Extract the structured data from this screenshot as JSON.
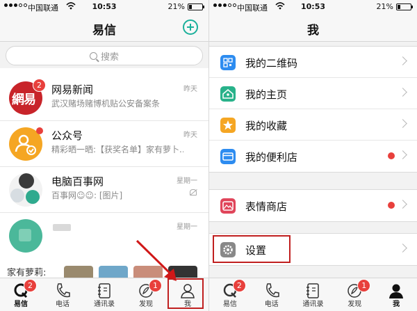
{
  "status_bar": {
    "carrier": "中国联通",
    "time": "10:53",
    "battery": "21%",
    "battery_level": 0.21
  },
  "left": {
    "title": "易信",
    "search": {
      "placeholder": "搜索"
    },
    "conversations": [
      {
        "name": "网易新闻",
        "time": "昨天",
        "preview": "武汉赌场赌博机贴公安备案条",
        "avatar_text": "網易",
        "unread": "2"
      },
      {
        "name": "公众号",
        "time": "昨天",
        "preview": "精彩晒一晒:【获奖名单】家有萝卜...",
        "unread_dot": true
      },
      {
        "name": "电脑百事网",
        "time": "星期一",
        "preview": "百事网☺☺: [图片]",
        "muted": true
      },
      {
        "name": "",
        "time": "星期一",
        "preview": ""
      }
    ],
    "partial_row_label": "家有萝莉:"
  },
  "right": {
    "title": "我",
    "groups": [
      [
        {
          "label": "我的二维码",
          "icon": "qr-code-icon",
          "color": "#2d8cf0"
        },
        {
          "label": "我的主页",
          "icon": "home-icon",
          "color": "#28b28a"
        },
        {
          "label": "我的收藏",
          "icon": "star-icon",
          "color": "#f5a623"
        },
        {
          "label": "我的便利店",
          "icon": "store-icon",
          "color": "#2d8cf0",
          "dot": true
        }
      ],
      [
        {
          "label": "表情商店",
          "icon": "sticker-icon",
          "color": "#e0455a",
          "dot": true
        }
      ],
      [
        {
          "label": "设置",
          "icon": "settings-icon",
          "color": "#888888"
        }
      ]
    ]
  },
  "tabbar": {
    "tabs": [
      {
        "label": "易信",
        "icon": "chat-icon",
        "badge": "2"
      },
      {
        "label": "电话",
        "icon": "phone-icon"
      },
      {
        "label": "通讯录",
        "icon": "contacts-icon"
      },
      {
        "label": "发现",
        "icon": "discover-icon",
        "badge": "1"
      },
      {
        "label": "我",
        "icon": "me-icon"
      }
    ]
  },
  "colors": {
    "accent": "#1bb09b",
    "badge": "#e8403c",
    "annotation": "#c01f1f"
  }
}
